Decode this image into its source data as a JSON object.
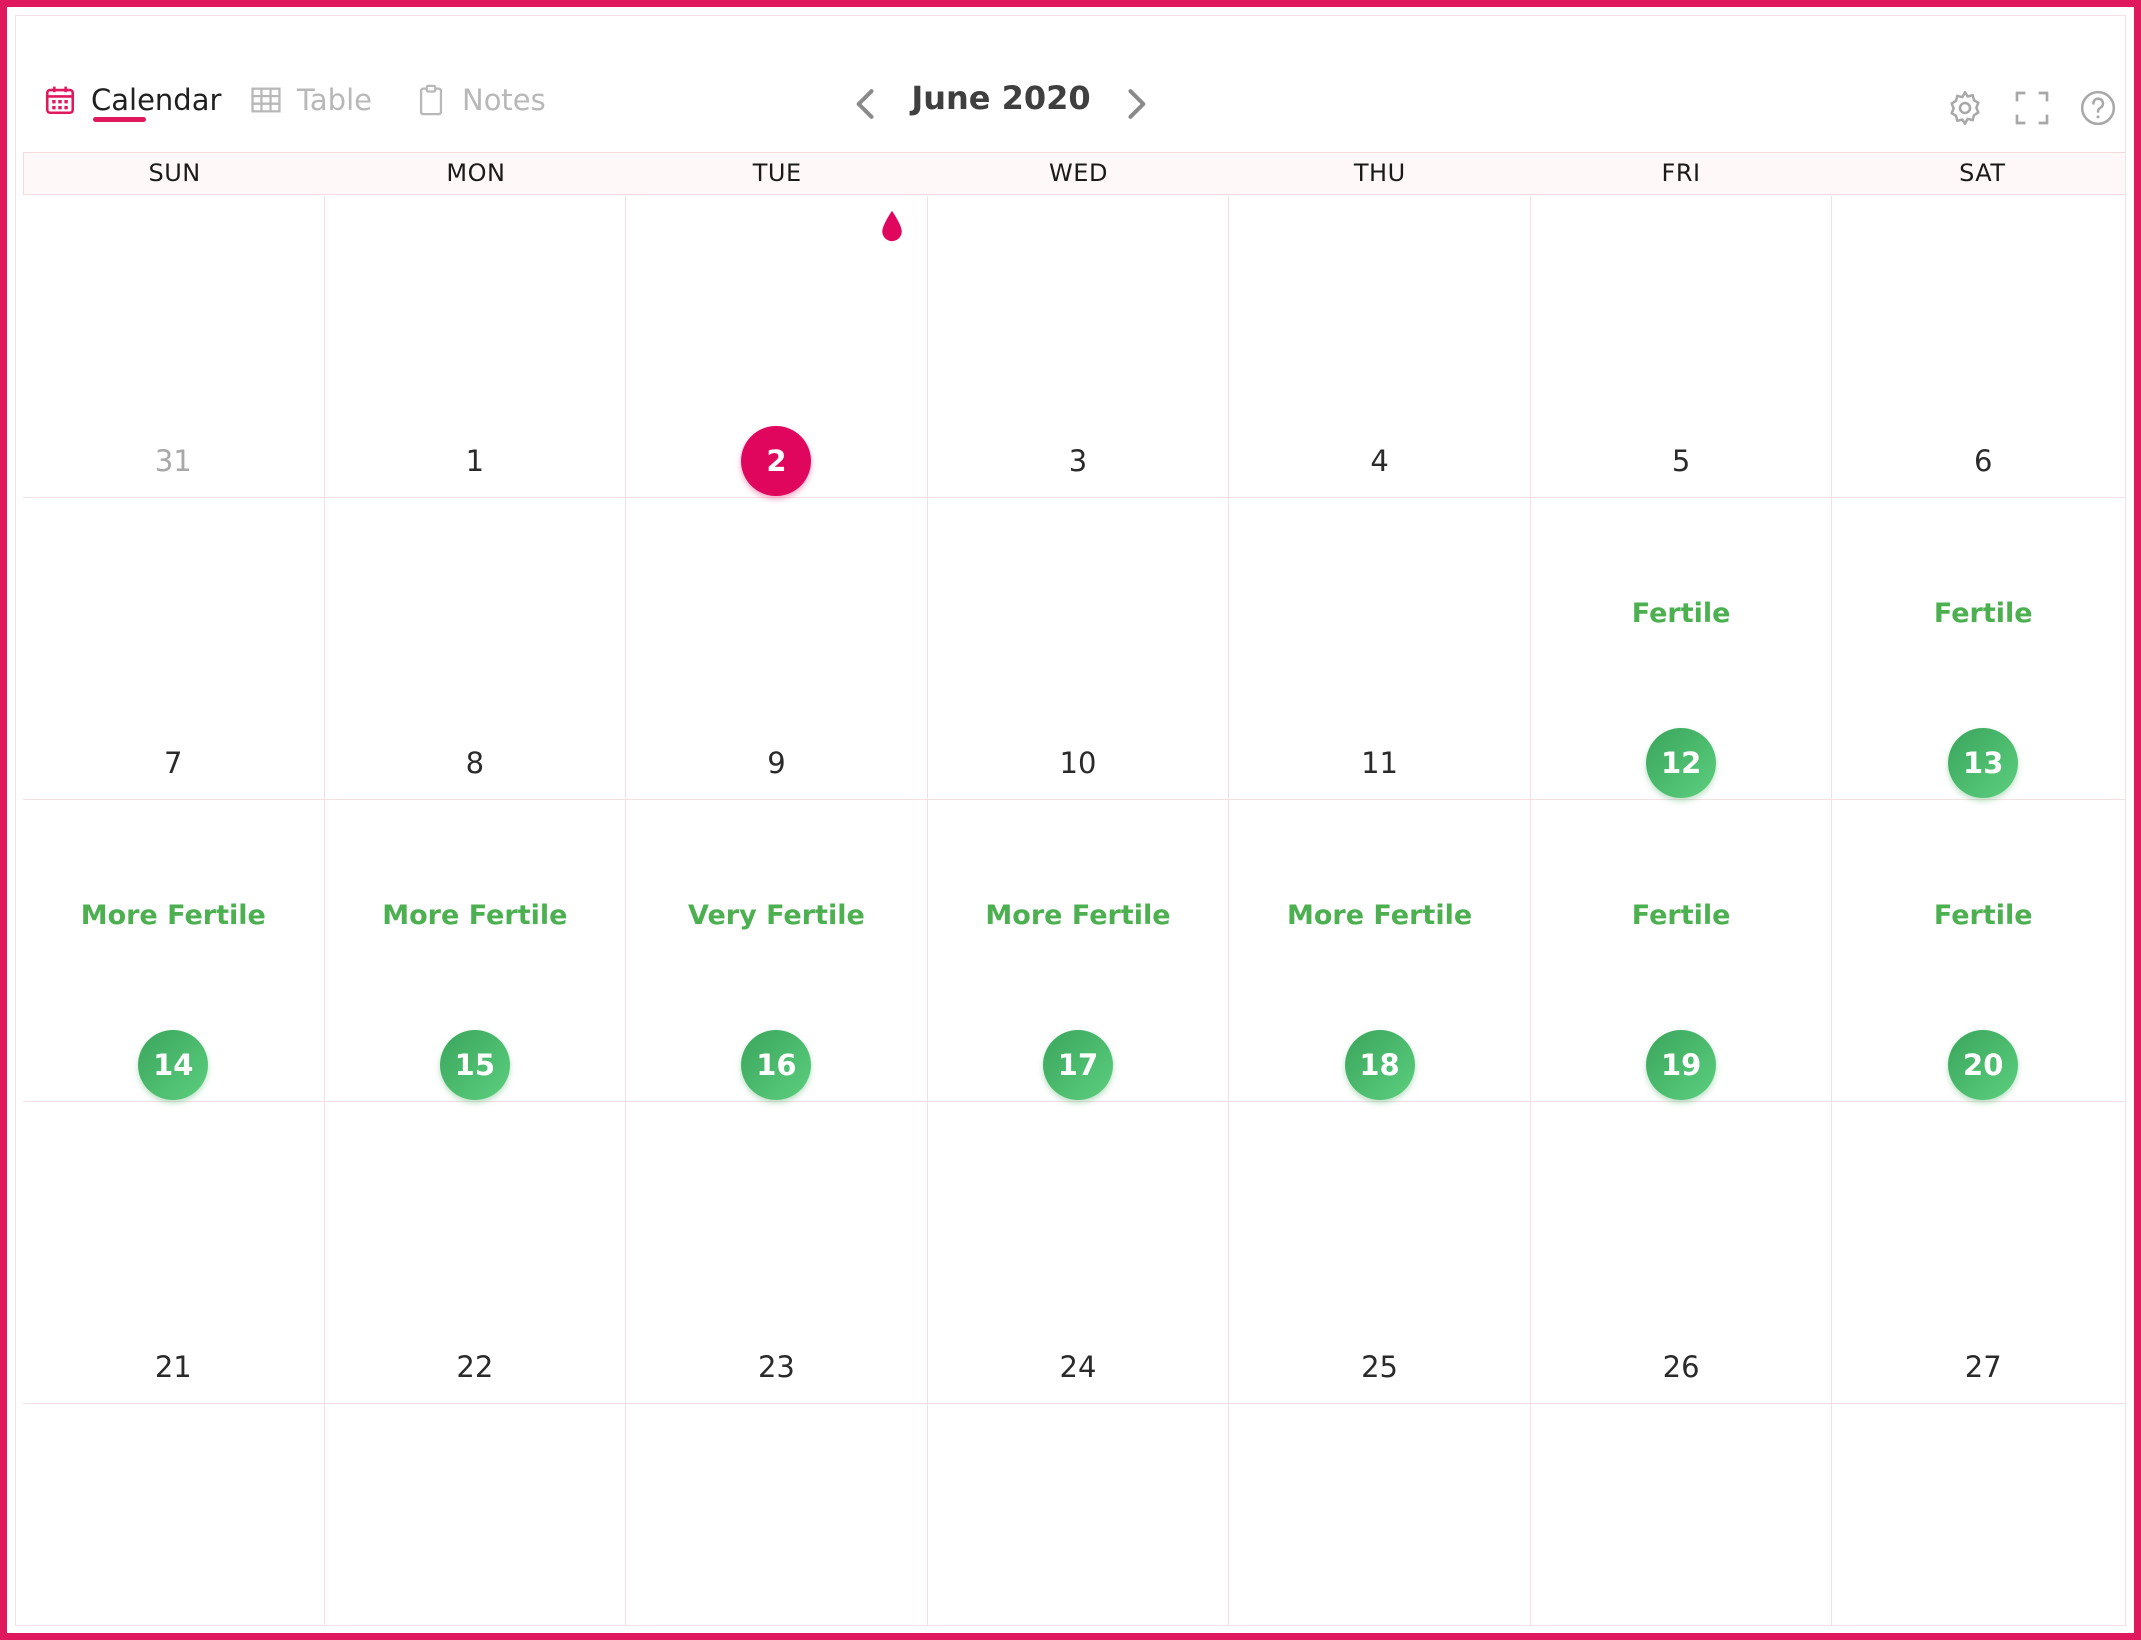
{
  "toolbar": {
    "tabs": {
      "calendar": "Calendar",
      "table": "Table",
      "notes": "Notes"
    },
    "active_tab": "calendar",
    "month_title": "June 2020",
    "icons": {
      "calendar": "calendar-icon",
      "table": "table-grid-icon",
      "notes": "clipboard-icon",
      "prev": "chevron-left-icon",
      "next": "chevron-right-icon",
      "settings": "gear-icon",
      "fullscreen": "fullscreen-icon",
      "help": "help-circle-icon"
    }
  },
  "weekdays": [
    "SUN",
    "MON",
    "TUE",
    "WED",
    "THU",
    "FRI",
    "SAT"
  ],
  "weeks": [
    [
      {
        "day": "31",
        "type": "other"
      },
      {
        "day": "1",
        "type": "normal"
      },
      {
        "day": "2",
        "type": "period",
        "marker": "blood-drop-icon"
      },
      {
        "day": "3",
        "type": "normal"
      },
      {
        "day": "4",
        "type": "normal"
      },
      {
        "day": "5",
        "type": "normal"
      },
      {
        "day": "6",
        "type": "normal"
      }
    ],
    [
      {
        "day": "7",
        "type": "normal"
      },
      {
        "day": "8",
        "type": "normal"
      },
      {
        "day": "9",
        "type": "normal"
      },
      {
        "day": "10",
        "type": "normal"
      },
      {
        "day": "11",
        "type": "normal"
      },
      {
        "day": "12",
        "type": "fertile",
        "label": "Fertile"
      },
      {
        "day": "13",
        "type": "fertile",
        "label": "Fertile"
      }
    ],
    [
      {
        "day": "14",
        "type": "fertile",
        "label": "More Fertile"
      },
      {
        "day": "15",
        "type": "fertile",
        "label": "More Fertile"
      },
      {
        "day": "16",
        "type": "fertile",
        "label": "Very Fertile"
      },
      {
        "day": "17",
        "type": "fertile",
        "label": "More Fertile"
      },
      {
        "day": "18",
        "type": "fertile",
        "label": "More Fertile"
      },
      {
        "day": "19",
        "type": "fertile",
        "label": "Fertile"
      },
      {
        "day": "20",
        "type": "fertile",
        "label": "Fertile"
      }
    ],
    [
      {
        "day": "21",
        "type": "normal"
      },
      {
        "day": "22",
        "type": "normal"
      },
      {
        "day": "23",
        "type": "normal"
      },
      {
        "day": "24",
        "type": "normal"
      },
      {
        "day": "25",
        "type": "normal"
      },
      {
        "day": "26",
        "type": "normal"
      },
      {
        "day": "27",
        "type": "normal"
      }
    ],
    [
      {
        "day": "",
        "type": "blank"
      },
      {
        "day": "",
        "type": "blank"
      },
      {
        "day": "",
        "type": "blank"
      },
      {
        "day": "",
        "type": "blank"
      },
      {
        "day": "",
        "type": "blank"
      },
      {
        "day": "",
        "type": "blank"
      },
      {
        "day": "",
        "type": "blank"
      }
    ]
  ],
  "colors": {
    "accent": "#e0195f",
    "period": "#e0065d",
    "fertile": "#4caf50",
    "grid_line": "#f6dfe2"
  }
}
